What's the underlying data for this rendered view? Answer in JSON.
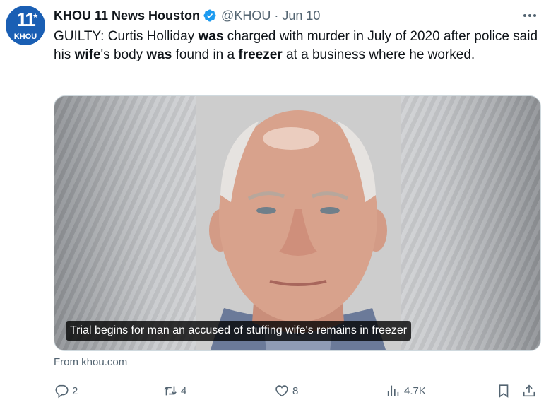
{
  "author": {
    "name": "KHOU 11 News Houston",
    "handle": "@KHOU",
    "separator": "·",
    "date": "Jun 10",
    "avatar_number": "11",
    "avatar_callsign": "KHOU",
    "verified_color": "#1d9bf0",
    "brand_color": "#1a5fb4"
  },
  "tweet": {
    "segments": [
      {
        "text": "GUILTY: Curtis Holliday ",
        "bold": false
      },
      {
        "text": "was",
        "bold": true
      },
      {
        "text": " charged with murder in July of 2020 after police said his ",
        "bold": false
      },
      {
        "text": "wife",
        "bold": true
      },
      {
        "text": "'s body ",
        "bold": false
      },
      {
        "text": "was",
        "bold": true
      },
      {
        "text": " found in a ",
        "bold": false
      },
      {
        "text": "freezer",
        "bold": true
      },
      {
        "text": " at a business where he worked.",
        "bold": false
      }
    ]
  },
  "card": {
    "caption": "Trial begins for man an accused of stuffing wife's remains in freezer",
    "source": "From khou.com"
  },
  "actions": {
    "replies": "2",
    "reposts": "4",
    "likes": "8",
    "views": "4.7K",
    "icons": [
      "reply-icon",
      "repost-icon",
      "like-icon",
      "views-icon",
      "bookmark-icon",
      "share-icon"
    ]
  }
}
